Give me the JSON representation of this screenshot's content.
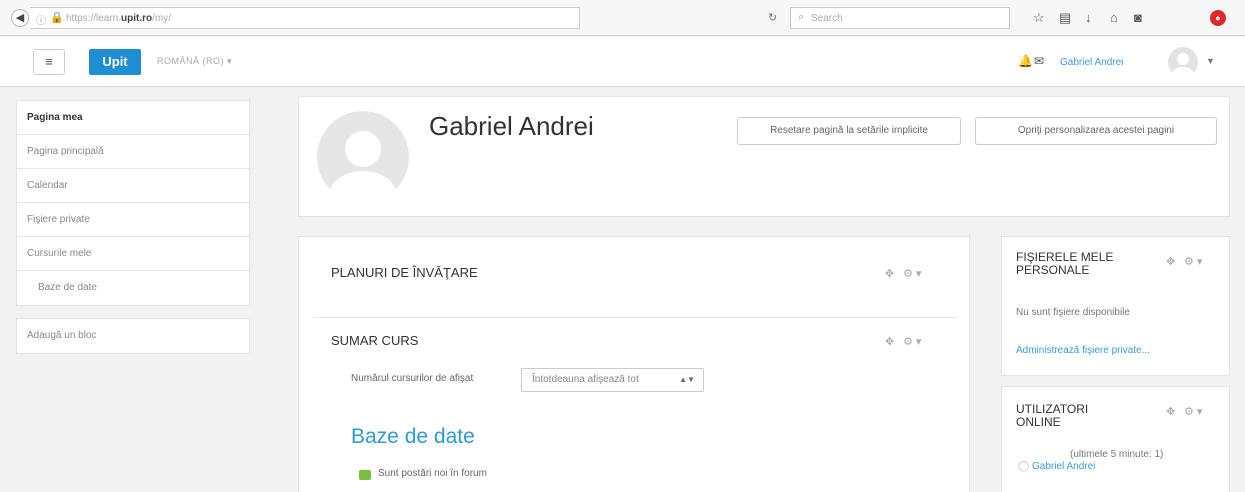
{
  "browser": {
    "url_prefix": "https://learn.",
    "url_domain": "upit.ro",
    "url_suffix": "/my/",
    "search_placeholder": "Search"
  },
  "navbar": {
    "brand": "Upit",
    "language": "ROMÂNĂ (RO) ▾",
    "user_name": "Gabriel Andrei"
  },
  "sidebar": {
    "items": [
      "Pagina mea",
      "Pagina principală",
      "Calendar",
      "Fişiere private",
      "Cursurile mele",
      "Baze de date"
    ],
    "add_block": "Adaugă un bloc"
  },
  "header": {
    "name": "Gabriel Andrei",
    "reset_button": "Resetare pagină la setările implicite",
    "stop_button": "Opriţi personalizarea acestei pagini"
  },
  "blocks": {
    "learning_plans": {
      "title": "PLANURI DE ÎNVĂŢARE"
    },
    "course_overview": {
      "title": "SUMAR CURS",
      "courses_label": "Numărul cursurilor de afişat",
      "courses_value": "Întotdeauna afişează tot",
      "course_name": "Baze de date",
      "forum_notice": "Sunt postări noi în forum"
    },
    "private_files": {
      "title": "FIŞIERELE MELE PERSONALE",
      "empty_text": "Nu sunt fişiere disponibile",
      "manage_link": "Administrează fişiere private..."
    },
    "online_users": {
      "title": "UTILIZATORI ONLINE",
      "info": "(ultimele 5 minute: 1)",
      "user": "Gabriel Andrei"
    }
  },
  "colors": {
    "brand": "#1e8dd2",
    "link": "#2a9bd7"
  }
}
